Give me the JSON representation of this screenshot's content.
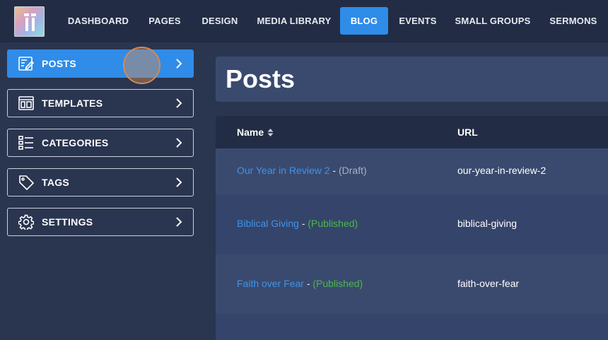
{
  "nav": {
    "items": [
      {
        "label": "DASHBOARD"
      },
      {
        "label": "PAGES"
      },
      {
        "label": "DESIGN"
      },
      {
        "label": "MEDIA LIBRARY"
      },
      {
        "label": "BLOG"
      },
      {
        "label": "EVENTS"
      },
      {
        "label": "SMALL GROUPS"
      },
      {
        "label": "SERMONS"
      }
    ],
    "active": "BLOG",
    "accent": "#2f8ce8"
  },
  "sidebar": {
    "items": [
      {
        "label": "POSTS",
        "icon": "posts-icon"
      },
      {
        "label": "TEMPLATES",
        "icon": "templates-icon"
      },
      {
        "label": "CATEGORIES",
        "icon": "list-icon"
      },
      {
        "label": "TAGS",
        "icon": "tag-icon"
      },
      {
        "label": "SETTINGS",
        "icon": "gear-icon"
      }
    ],
    "active": "POSTS"
  },
  "page": {
    "title": "Posts"
  },
  "table": {
    "columns": [
      {
        "label": "Name",
        "sortable": true
      },
      {
        "label": "URL"
      }
    ],
    "separator": " - ",
    "rows": [
      {
        "name": "Our Year in Review 2",
        "status": "(Draft)",
        "status_type": "draft",
        "url": "our-year-in-review-2"
      },
      {
        "name": "Biblical Giving",
        "status": "(Published)",
        "status_type": "published",
        "url": "biblical-giving"
      },
      {
        "name": "Faith over Fear",
        "status": "(Published)",
        "status_type": "published",
        "url": "faith-over-fear"
      }
    ]
  },
  "colors": {
    "link": "#3d94ea",
    "published": "#4bb84a",
    "draft": "#a8b0c0",
    "background": "#2a3550",
    "header": "#222c44"
  }
}
